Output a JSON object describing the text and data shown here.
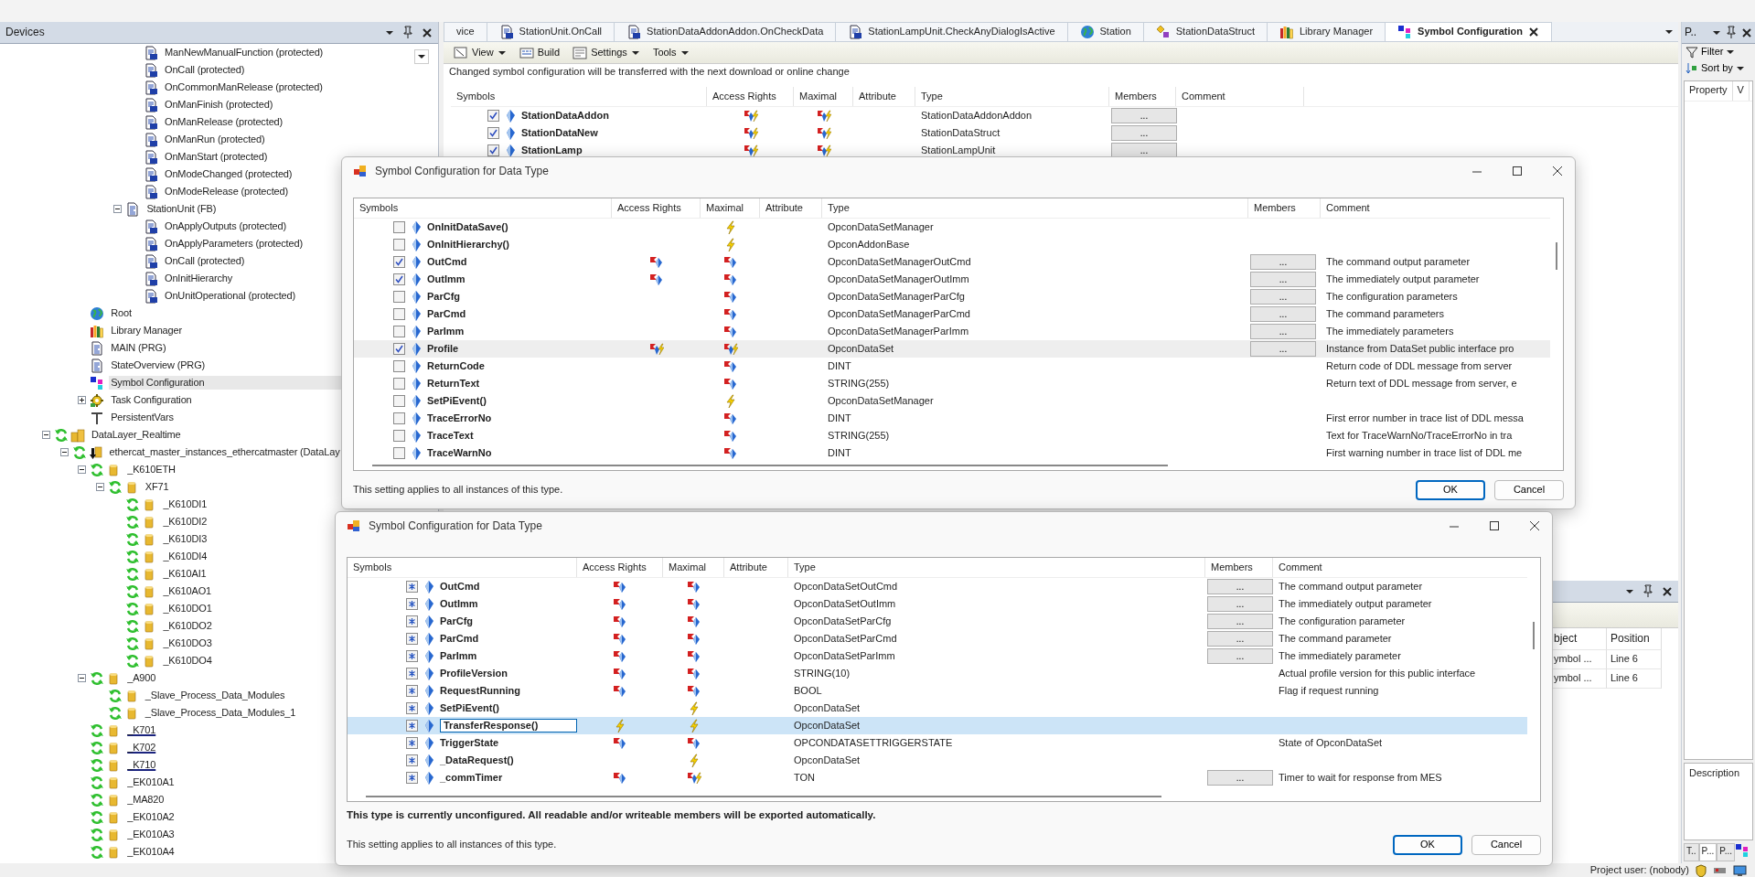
{
  "devices_panel": {
    "title": "Devices",
    "tree": [
      {
        "children": [
          {
            "children": [
              {
                "children": [
                  {
                    "children": [
                      {
                        "children": [
                          {
                            "label": "ManNewManualFunction (protected)",
                            "kind": "method"
                          },
                          {
                            "label": "OnCall (protected)",
                            "kind": "method"
                          },
                          {
                            "label": "OnCommonManRelease (protected)",
                            "kind": "method"
                          },
                          {
                            "label": "OnManFinish (protected)",
                            "kind": "method"
                          },
                          {
                            "label": "OnManRelease (protected)",
                            "kind": "method"
                          },
                          {
                            "label": "OnManRun (protected)",
                            "kind": "method"
                          },
                          {
                            "label": "OnManStart (protected)",
                            "kind": "method"
                          },
                          {
                            "label": "OnModeChanged (protected)",
                            "kind": "method"
                          },
                          {
                            "label": "OnModeRelease (protected)",
                            "kind": "method"
                          }
                        ]
                      },
                      {
                        "label": "StationUnit (FB)",
                        "kind": "pou",
                        "expanded": true,
                        "children": [
                          {
                            "label": "OnApplyOutputs (protected)",
                            "kind": "method"
                          },
                          {
                            "label": "OnApplyParameters (protected)",
                            "kind": "method"
                          },
                          {
                            "label": "OnCall (protected)",
                            "kind": "method"
                          },
                          {
                            "label": "OnInitHierarchy",
                            "kind": "method"
                          },
                          {
                            "label": "OnUnitOperational (protected)",
                            "kind": "method"
                          }
                        ]
                      }
                    ]
                  }
                ]
              },
              {
                "label": "Root",
                "kind": "globe",
                "selected": false
              },
              {
                "label": "Library Manager",
                "kind": "library",
                "selected": false
              },
              {
                "label": "MAIN (PRG)",
                "kind": "pou",
                "selected": false
              },
              {
                "label": "StateOverview (PRG)",
                "kind": "pou",
                "selected": false
              },
              {
                "label": "Symbol Configuration",
                "kind": "symbols",
                "selected": true
              },
              {
                "label": "Task Configuration",
                "kind": "task",
                "expanded": false,
                "selected": false
              },
              {
                "label": "PersistentVars",
                "kind": "persistent",
                "selected": false
              }
            ]
          }
        ]
      },
      {
        "label": "DataLayer_Realtime",
        "kind": "datalayer",
        "expanded": true,
        "children": [
          {
            "label": "ethercat_master_instances_ethercatmaster (DataLay",
            "kind": "ethercat",
            "expanded": true,
            "children": [
              {
                "label": "_K610ETH",
                "kind": "device",
                "expanded": true,
                "underlined": false,
                "children": [
                  {
                    "label": "XF71",
                    "kind": "device",
                    "expanded": true,
                    "children": [
                      {
                        "label": "_K610DI1",
                        "kind": "device"
                      },
                      {
                        "label": "_K610DI2",
                        "kind": "device"
                      },
                      {
                        "label": "_K610DI3",
                        "kind": "device"
                      },
                      {
                        "label": "_K610DI4",
                        "kind": "device"
                      },
                      {
                        "label": "_K610AI1",
                        "kind": "device"
                      },
                      {
                        "label": "_K610AO1",
                        "kind": "device"
                      },
                      {
                        "label": "_K610DO1",
                        "kind": "device"
                      },
                      {
                        "label": "_K610DO2",
                        "kind": "device"
                      },
                      {
                        "label": "_K610DO3",
                        "kind": "device"
                      },
                      {
                        "label": "_K610DO4",
                        "kind": "device"
                      }
                    ]
                  }
                ]
              },
              {
                "label": "_A900",
                "kind": "device",
                "expanded": true,
                "underlined": false,
                "children": [
                  {
                    "label": "_Slave_Process_Data_Modules",
                    "kind": "device"
                  },
                  {
                    "label": "_Slave_Process_Data_Modules_1",
                    "kind": "device"
                  }
                ]
              },
              {
                "label": "_K701",
                "kind": "device",
                "underlined": true
              },
              {
                "label": "_K702",
                "kind": "device",
                "underlined": true
              },
              {
                "label": "_K710",
                "kind": "device",
                "underlined": true
              },
              {
                "label": "_EK010A1",
                "kind": "device",
                "underlined": false
              },
              {
                "label": "_MA820",
                "kind": "device",
                "underlined": false
              },
              {
                "label": "_EK010A2",
                "kind": "device",
                "underlined": false
              },
              {
                "label": "_EK010A3",
                "kind": "device",
                "underlined": false
              },
              {
                "label": "_EK010A4",
                "kind": "device",
                "underlined": false
              }
            ]
          }
        ]
      }
    ]
  },
  "editor": {
    "tabs": [
      {
        "label": "vice",
        "kind": "plain",
        "selected": false
      },
      {
        "label": "StationUnit.OnCall",
        "kind": "method",
        "selected": false
      },
      {
        "label": "StationDataAddonAddon.OnCheckData",
        "kind": "method",
        "selected": false
      },
      {
        "label": "StationLampUnit.CheckAnyDialogIsActive",
        "kind": "method",
        "selected": false
      },
      {
        "label": "Station",
        "kind": "globe",
        "selected": false
      },
      {
        "label": "StationDataStruct",
        "kind": "struct",
        "selected": false
      },
      {
        "label": "Library Manager",
        "kind": "library",
        "selected": false
      },
      {
        "label": "Symbol Configuration",
        "kind": "symbols",
        "selected": true
      }
    ],
    "toolbar": [
      {
        "label": "View",
        "kind": "view",
        "menu": true
      },
      {
        "label": "Build",
        "kind": "build",
        "menu": false
      },
      {
        "label": "Settings",
        "kind": "settings",
        "menu": true
      },
      {
        "label": "Tools",
        "kind": "plain",
        "menu": true
      }
    ],
    "info": "Changed symbol configuration will be transferred with the next download or online change",
    "table": {
      "columns": [
        "Symbols",
        "Access Rights",
        "Maximal",
        "Attribute",
        "Type",
        "Members",
        "Comment"
      ],
      "rows": [
        {
          "symbol": "StationDataAddon",
          "checked": true,
          "access": {
            "kind": "rw-exec"
          },
          "maximal": {
            "kind": "rw-exec"
          },
          "type": "StationDataAddonAddon",
          "members": "..."
        },
        {
          "symbol": "StationDataNew",
          "checked": true,
          "access": {
            "kind": "rw-exec"
          },
          "maximal": {
            "kind": "rw-exec"
          },
          "type": "StationDataStruct",
          "members": "..."
        },
        {
          "symbol": "StationLamp",
          "checked": true,
          "access": {
            "kind": "rw-exec"
          },
          "maximal": {
            "kind": "rw-exec"
          },
          "type": "StationLampUnit",
          "members": "..."
        }
      ]
    }
  },
  "messages_panel": {
    "columns": [
      "bject",
      "Position"
    ],
    "rows": [
      [
        "ymbol ...",
        "Line 6"
      ],
      [
        "ymbol ...",
        "Line 6"
      ]
    ]
  },
  "properties_panel": {
    "title": "P..",
    "filter": "Filter",
    "sort": "Sort by",
    "columns": [
      "Property",
      "V"
    ],
    "description": "Description",
    "tabs": [
      {
        "label": "T..",
        "selected": false
      },
      {
        "label": "P...",
        "selected": true
      },
      {
        "label": "P...",
        "selected": false
      }
    ]
  },
  "dialogs": [
    {
      "title": "Symbol Configuration for Data Type",
      "columns": [
        "Symbols",
        "Access Rights",
        "Maximal",
        "Attribute",
        "Type",
        "Members",
        "Comment"
      ],
      "rows": [
        {
          "symbol": "OnInitDataSave()",
          "checked": false,
          "maximal": {
            "kind": "exec"
          },
          "type": "OpconDataSetManager",
          "selected": false
        },
        {
          "symbol": "OnInitHierarchy()",
          "checked": false,
          "maximal": {
            "kind": "exec"
          },
          "type": "OpconAddonBase",
          "selected": false
        },
        {
          "symbol": "OutCmd",
          "checked": true,
          "access": {
            "kind": "rw"
          },
          "maximal": {
            "kind": "rw"
          },
          "type": "OpconDataSetManagerOutCmd",
          "members": "...",
          "comment": "The command output parameter",
          "selected": false
        },
        {
          "symbol": "OutImm",
          "checked": true,
          "access": {
            "kind": "rw"
          },
          "maximal": {
            "kind": "rw"
          },
          "type": "OpconDataSetManagerOutImm",
          "members": "...",
          "comment": "The immediately output parameter",
          "selected": false
        },
        {
          "symbol": "ParCfg",
          "checked": false,
          "maximal": {
            "kind": "rw"
          },
          "type": "OpconDataSetManagerParCfg",
          "members": "...",
          "comment": "The configuration parameters",
          "selected": false
        },
        {
          "symbol": "ParCmd",
          "checked": false,
          "maximal": {
            "kind": "rw"
          },
          "type": "OpconDataSetManagerParCmd",
          "members": "...",
          "comment": "The command parameters",
          "selected": false
        },
        {
          "symbol": "ParImm",
          "checked": false,
          "maximal": {
            "kind": "rw"
          },
          "type": "OpconDataSetManagerParImm",
          "members": "...",
          "comment": "The immediately parameters",
          "selected": false
        },
        {
          "symbol": "Profile",
          "checked": true,
          "access": {
            "kind": "rw-exec"
          },
          "maximal": {
            "kind": "rw-exec"
          },
          "type": "OpconDataSet",
          "members": "...",
          "comment": "Instance from DataSet public interface pro",
          "selected": true
        },
        {
          "symbol": "ReturnCode",
          "checked": false,
          "maximal": {
            "kind": "rw"
          },
          "type": "DINT",
          "comment": "Return code of DDL message from server",
          "selected": false
        },
        {
          "symbol": "ReturnText",
          "checked": false,
          "maximal": {
            "kind": "rw"
          },
          "type": "STRING(255)",
          "comment": "Return text of DDL message from server, e",
          "selected": false
        },
        {
          "symbol": "SetPiEvent()",
          "checked": false,
          "maximal": {
            "kind": "exec"
          },
          "type": "OpconDataSetManager",
          "selected": false
        },
        {
          "symbol": "TraceErrorNo",
          "checked": false,
          "maximal": {
            "kind": "rw"
          },
          "type": "DINT",
          "comment": "First error number in trace list of DDL messa",
          "selected": false
        },
        {
          "symbol": "TraceText",
          "checked": false,
          "maximal": {
            "kind": "rw"
          },
          "type": "STRING(255)",
          "comment": "Text for TraceWarnNo/TraceErrorNo in tra",
          "selected": false
        },
        {
          "symbol": "TraceWarnNo",
          "checked": false,
          "maximal": {
            "kind": "rw"
          },
          "type": "DINT",
          "comment": "First warning number in trace list of DDL me",
          "selected": false
        }
      ],
      "footer": "This setting applies to all instances of this type.",
      "buttons": [
        {
          "label": "OK",
          "default": true
        },
        {
          "label": "Cancel",
          "default": false
        }
      ]
    },
    {
      "title": "Symbol Configuration for Data Type",
      "columns": [
        "Symbols",
        "Access Rights",
        "Maximal",
        "Attribute",
        "Type",
        "Members",
        "Comment"
      ],
      "rows": [
        {
          "symbol": "OutCmd",
          "indeterminate": true,
          "access": {
            "kind": "rw"
          },
          "maximal": {
            "kind": "rw"
          },
          "type": "OpconDataSetOutCmd",
          "members": "...",
          "comment": "The command output parameter",
          "selected": false
        },
        {
          "symbol": "OutImm",
          "indeterminate": true,
          "access": {
            "kind": "rw"
          },
          "maximal": {
            "kind": "rw"
          },
          "type": "OpconDataSetOutImm",
          "members": "...",
          "comment": "The immediately output parameter",
          "selected": false
        },
        {
          "symbol": "ParCfg",
          "indeterminate": true,
          "access": {
            "kind": "rw"
          },
          "maximal": {
            "kind": "rw"
          },
          "type": "OpconDataSetParCfg",
          "members": "...",
          "comment": "The configuration parameter",
          "selected": false
        },
        {
          "symbol": "ParCmd",
          "indeterminate": true,
          "access": {
            "kind": "rw"
          },
          "maximal": {
            "kind": "rw"
          },
          "type": "OpconDataSetParCmd",
          "members": "...",
          "comment": "The command parameter",
          "selected": false
        },
        {
          "symbol": "ParImm",
          "indeterminate": true,
          "access": {
            "kind": "rw"
          },
          "maximal": {
            "kind": "rw"
          },
          "type": "OpconDataSetParImm",
          "members": "...",
          "comment": "The immediately parameter",
          "selected": false
        },
        {
          "symbol": "ProfileVersion",
          "indeterminate": true,
          "access": {
            "kind": "rw"
          },
          "maximal": {
            "kind": "rw"
          },
          "type": "STRING(10)",
          "comment": "Actual profile version for this public interface",
          "selected": false
        },
        {
          "symbol": "RequestRunning",
          "indeterminate": true,
          "access": {
            "kind": "rw"
          },
          "maximal": {
            "kind": "rw"
          },
          "type": "BOOL",
          "comment": "Flag if request running",
          "selected": false
        },
        {
          "symbol": "SetPiEvent()",
          "indeterminate": true,
          "maximal": {
            "kind": "exec"
          },
          "type": "OpconDataSet",
          "selected": false
        },
        {
          "symbol": "TransferResponse()",
          "indeterminate": true,
          "access": {
            "kind": "exec"
          },
          "maximal": {
            "kind": "exec"
          },
          "type": "OpconDataSet",
          "selected": true
        },
        {
          "symbol": "TriggerState",
          "indeterminate": true,
          "access": {
            "kind": "rw"
          },
          "maximal": {
            "kind": "rw"
          },
          "type": "OPCONDATASETTRIGGERSTATE",
          "comment": "State of OpconDataSet",
          "selected": false
        },
        {
          "symbol": "_DataRequest()",
          "indeterminate": true,
          "maximal": {
            "kind": "exec"
          },
          "type": "OpconDataSet",
          "selected": false
        },
        {
          "symbol": "_commTimer",
          "indeterminate": true,
          "access": {
            "kind": "rw"
          },
          "maximal": {
            "kind": "rw-exec"
          },
          "type": "TON",
          "members": "...",
          "comment": "Timer to wait for response from MES",
          "selected": false
        }
      ],
      "message": "This type is currently unconfigured. All readable and/or writeable members will be exported automatically.",
      "footer": "This setting applies to all instances of this type.",
      "buttons": [
        {
          "label": "OK",
          "default": true
        },
        {
          "label": "Cancel",
          "default": false
        }
      ]
    }
  ],
  "status_bar": {
    "user": "Project user: (nobody)"
  }
}
